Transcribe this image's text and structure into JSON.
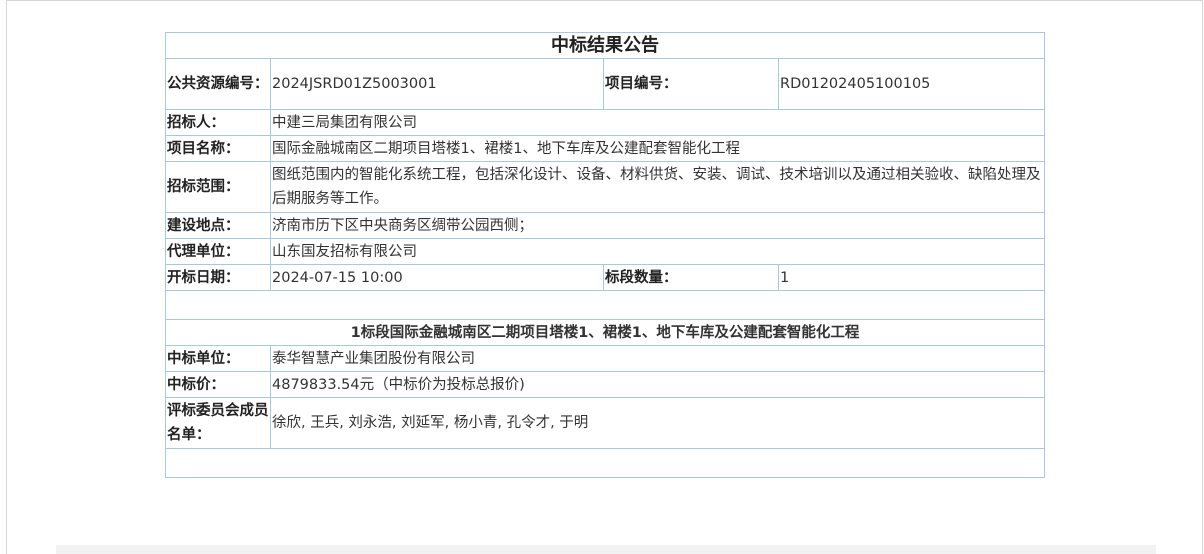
{
  "notice": {
    "title": "中标结果公告",
    "rows": {
      "resource_no_label": "公共资源编号：",
      "resource_no_value": "2024JSRD01Z5003001",
      "project_no_label": "项目编号：",
      "project_no_value": "RD01202405100105",
      "tenderer_label": "招标人：",
      "tenderer_value": "中建三局集团有限公司",
      "project_name_label": "项目名称：",
      "project_name_value": "国际金融城南区二期项目塔楼1、裙楼1、地下车库及公建配套智能化工程",
      "scope_label": "招标范围：",
      "scope_value": "图纸范围内的智能化系统工程，包括深化设计、设备、材料供货、安装、调试、技术培训以及通过相关验收、缺陷处理及后期服务等工作。",
      "location_label": "建设地点：",
      "location_value": "济南市历下区中央商务区绸带公园西侧；",
      "agency_label": "代理单位：",
      "agency_value": "山东国友招标有限公司",
      "open_date_label": "开标日期：",
      "open_date_value": "2024-07-15 10:00",
      "lot_count_label": "标段数量：",
      "lot_count_value": "1"
    },
    "lot": {
      "heading": "1标段国际金融城南区二期项目塔楼1、裙楼1、地下车库及公建配套智能化工程",
      "winner_label": "中标单位：",
      "winner_value": "泰华智慧产业集团股份有限公司",
      "price_label": "中标价：",
      "price_value": "4879833.54元（中标价为投标总报价)",
      "committee_label": "评标委员会成员名单：",
      "committee_value": "徐欣, 王兵, 刘永浩, 刘延军, 杨小青, 孔令才, 于明"
    }
  }
}
